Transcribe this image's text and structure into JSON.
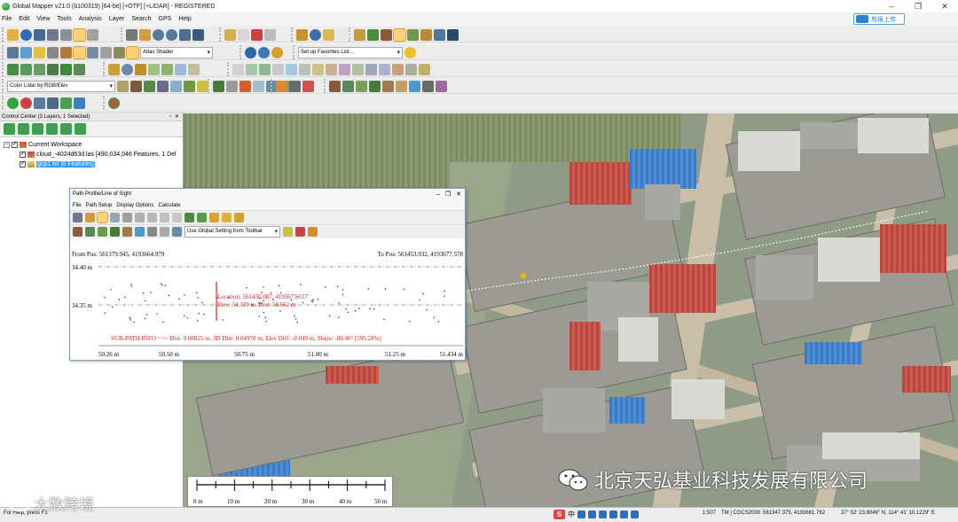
{
  "window": {
    "title": "Global Mapper v21.0 (b100319) [64-bit] [+OTF] [+LIDAR] - REGISTERED",
    "controls": [
      "–",
      "❐",
      "✕"
    ],
    "cloud_button": "剪报上传"
  },
  "menu": [
    "File",
    "Edit",
    "View",
    "Tools",
    "Analysis",
    "Layer",
    "Search",
    "GPS",
    "Help"
  ],
  "toolbars": {
    "shader_combo": "Atlas Shader",
    "favorites_combo": "Set up Favorites List...",
    "lidar_combo": "Color Lidar by RGB/Elev"
  },
  "control_center": {
    "header": "Control Center (3 Layers, 1 Selected)",
    "header_buttons": [
      "▫",
      "✕"
    ],
    "tree": [
      {
        "label": "Current Workspace",
        "selected": false
      },
      {
        "label": "cloud_-4024d63d.las [490,034,046 Features, 1 Del",
        "selected": false
      },
      {
        "label": "gcp1.txt [6 Features]",
        "selected": true
      }
    ]
  },
  "path_profile": {
    "title": "Path Profile/Line of Sight",
    "window_buttons": [
      "–",
      "❐",
      "✕"
    ],
    "menu": [
      "File",
      "Path Setup",
      "Display Options",
      "Calculate"
    ],
    "toolbar_combo": "Use Global Setting from Toolbar",
    "from_pos": "From Pos: 561379.945, 4193664.979",
    "to_pos": "To Pos: 561453.932, 4193677.578",
    "y_labels": [
      "34.40 m",
      "34.35 m"
    ],
    "location_text": "Location: 561430.087, 4193673.517",
    "elev_text": "Elev: 34.329 m, Dist: 50.662 m",
    "subpath_text": "SUB-PATH INFO ==> Dist: 0.00825 m, 3D Dist: 0.04978 m, Elev Diff: -0.049 m, Slope: -80.46° [595.28%]",
    "x_labels": [
      "50.26 m",
      "50.50 m",
      "50.75 m",
      "51.00 m",
      "51.25 m",
      "51.434 m"
    ]
  },
  "scale_bar": {
    "labels": [
      "0 m",
      "10 m",
      "20 m",
      "30 m",
      "40 m",
      "50 m"
    ]
  },
  "status": {
    "left": "For Help, press F1",
    "scale": "1:507",
    "proj": "TM | CGCS2000",
    "coords": "561347.375, 4193661.762",
    "latlon": "37° 52' 23.8046\" N, 114° 41' 10.1229\" E",
    "ime_letter": "S",
    "ime_mode": "中"
  },
  "watermarks": {
    "company": "北京天弘基业科技发展有限公司",
    "left": "大数跨境"
  },
  "colors": {
    "profile_red": "#e02020",
    "selection_blue": "#3399ff"
  }
}
